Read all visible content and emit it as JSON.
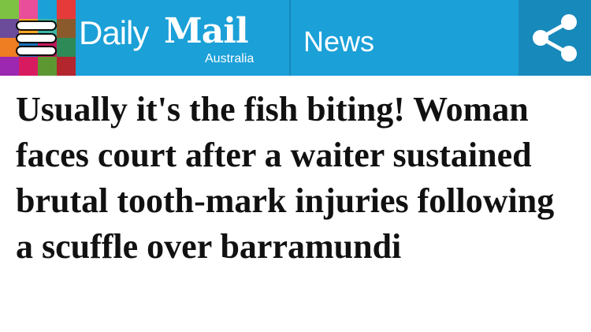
{
  "header": {
    "brand": {
      "daily": "Daily",
      "mail": "Mail",
      "edition": "Australia"
    },
    "section": "News",
    "colors": {
      "bar": "#1ba0d8",
      "share_bg": "#1789bb",
      "text": "#ffffff"
    },
    "icons": {
      "menu": "hamburger-menu-icon",
      "share": "share-icon"
    }
  },
  "article": {
    "headline": "Usually it's the fish biting! Woman faces court after a waiter sustained brutal tooth-mark injuries following a scuffle over barramundi"
  }
}
